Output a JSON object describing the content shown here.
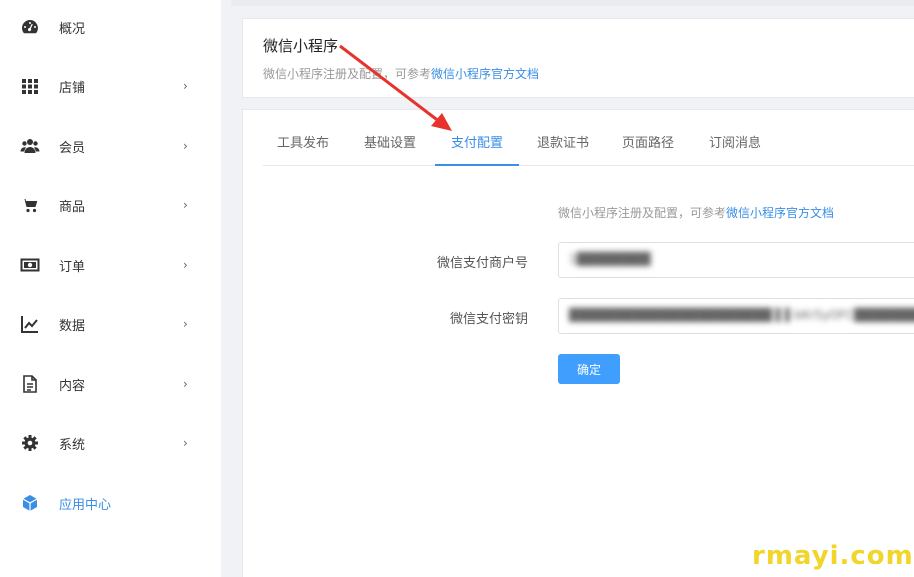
{
  "sidebar": {
    "items": [
      {
        "label": "概况",
        "icon": "dashboard-icon",
        "has_arrow": false
      },
      {
        "label": "店铺",
        "icon": "grid-icon",
        "has_arrow": true
      },
      {
        "label": "会员",
        "icon": "users-icon",
        "has_arrow": true
      },
      {
        "label": "商品",
        "icon": "cart-icon",
        "has_arrow": true
      },
      {
        "label": "订单",
        "icon": "money-icon",
        "has_arrow": true
      },
      {
        "label": "数据",
        "icon": "chart-icon",
        "has_arrow": true
      },
      {
        "label": "内容",
        "icon": "document-icon",
        "has_arrow": true
      },
      {
        "label": "系统",
        "icon": "gear-icon",
        "has_arrow": true
      },
      {
        "label": "应用中心",
        "icon": "cube-icon",
        "has_arrow": false,
        "active": true
      }
    ],
    "arrow_glyph": "›"
  },
  "header": {
    "title": "微信小程序",
    "subtitle_prefix": "微信小程序注册及配置，可参考",
    "subtitle_link": "微信小程序官方文档"
  },
  "tabs": [
    {
      "label": "工具发布"
    },
    {
      "label": "基础设置"
    },
    {
      "label": "支付配置",
      "active": true
    },
    {
      "label": "退款证书"
    },
    {
      "label": "页面路径"
    },
    {
      "label": "订阅消息"
    }
  ],
  "form": {
    "hint_prefix": "微信小程序注册及配置，可参考",
    "hint_link": "微信小程序官方文档",
    "merchant_id_label": "微信支付商户号",
    "merchant_id_value": "1████████",
    "secret_label": "微信支付密钥",
    "secret_value": "██████████████████████ ▌▌bKr5yOFC████████",
    "submit_label": "确定"
  },
  "watermark": "rmayi.com",
  "colors": {
    "accent": "#3a8ee6",
    "button": "#409eff",
    "annotation_arrow": "#e8322d",
    "watermark": "#f2d52b"
  }
}
